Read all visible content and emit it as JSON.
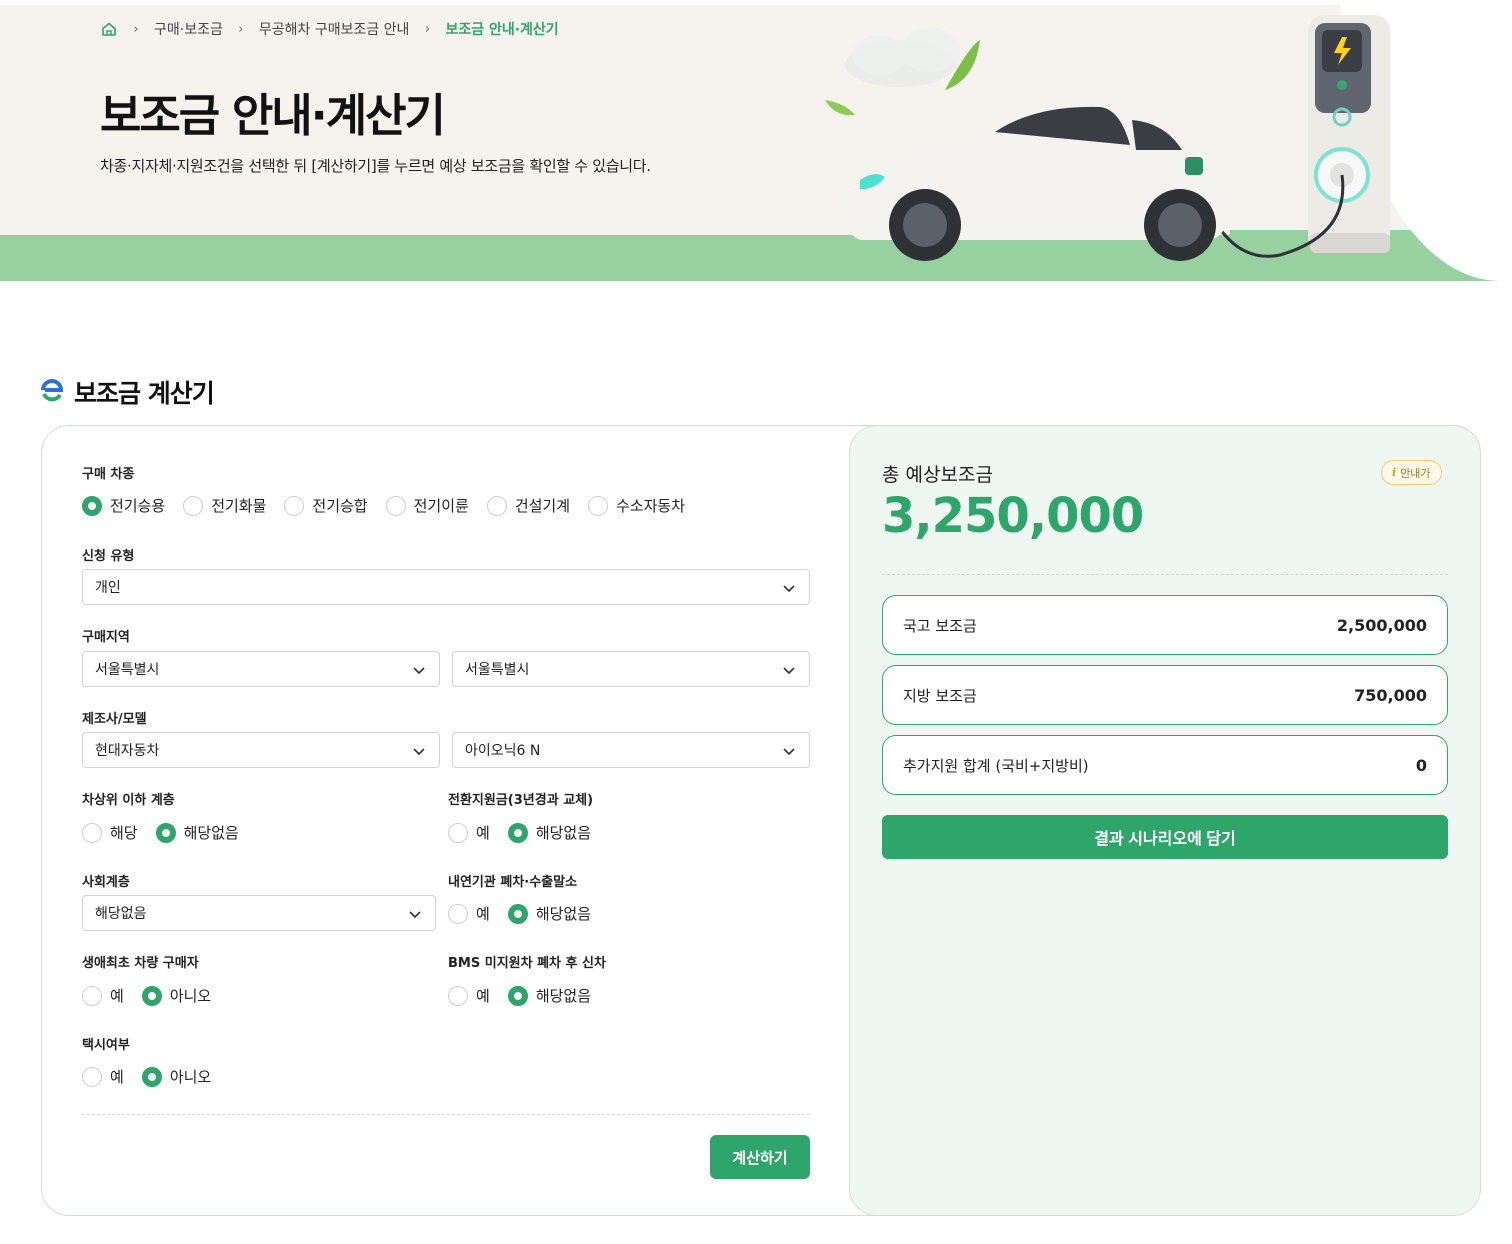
{
  "breadcrumb": {
    "items": [
      "구매·보조금",
      "무공해차 구매보조금 안내",
      "보조금 안내·계산기"
    ]
  },
  "hero": {
    "title": "보조금 안내·계산기",
    "description": "차종·지자체·지원조건을 선택한 뒤 [계산하기]를 누르면 예상 보조금을 확인할 수 있습니다."
  },
  "section": {
    "title": "보조금 계산기"
  },
  "form": {
    "vehicle_type": {
      "label": "구매 차종",
      "options": [
        "전기승용",
        "전기화물",
        "전기승합",
        "전기이륜",
        "건설기계",
        "수소자동차"
      ],
      "selected": "전기승용"
    },
    "apply_type": {
      "label": "신청 유형",
      "value": "개인"
    },
    "region": {
      "label": "구매지역",
      "value1": "서울특별시",
      "value2": "서울특별시"
    },
    "maker_model": {
      "label": "제조사/모델",
      "maker": "현대자동차",
      "model": "아이오닉6 N"
    },
    "low_income": {
      "label": "차상위 이하 계층",
      "options": [
        "해당",
        "해당없음"
      ],
      "selected": "해당없음"
    },
    "conversion": {
      "label": "전환지원금(3년경과 교체)",
      "options": [
        "예",
        "해당없음"
      ],
      "selected": "해당없음"
    },
    "social_class": {
      "label": "사회계층",
      "value": "해당없음"
    },
    "ice_scrap": {
      "label": "내연기관 폐차·수출말소",
      "options": [
        "예",
        "해당없음"
      ],
      "selected": "해당없음"
    },
    "first_buyer": {
      "label": "생애최초 차량 구매자",
      "options": [
        "예",
        "아니오"
      ],
      "selected": "아니오"
    },
    "bms": {
      "label": "BMS 미지원차 폐차 후 신차",
      "options": [
        "예",
        "해당없음"
      ],
      "selected": "해당없음"
    },
    "taxi": {
      "label": "택시여부",
      "options": [
        "예",
        "아니오"
      ],
      "selected": "아니오"
    },
    "calculate_label": "계산하기"
  },
  "result": {
    "total_label": "총 예상보조금",
    "info_label": "안내가",
    "total_value": "3,250,000",
    "items": [
      {
        "label": "국고 보조금",
        "value": "2,500,000"
      },
      {
        "label": "지방 보조금",
        "value": "750,000"
      },
      {
        "label": "추가지원 합계 (국비+지방비)",
        "value": "0"
      }
    ],
    "save_label": "결과 시나리오에 담기"
  },
  "colors": {
    "accent": "#2ea56a",
    "hero_bg": "#f6f3ee",
    "grass": "#97d1a0",
    "result_bg": "#eef7f2"
  }
}
